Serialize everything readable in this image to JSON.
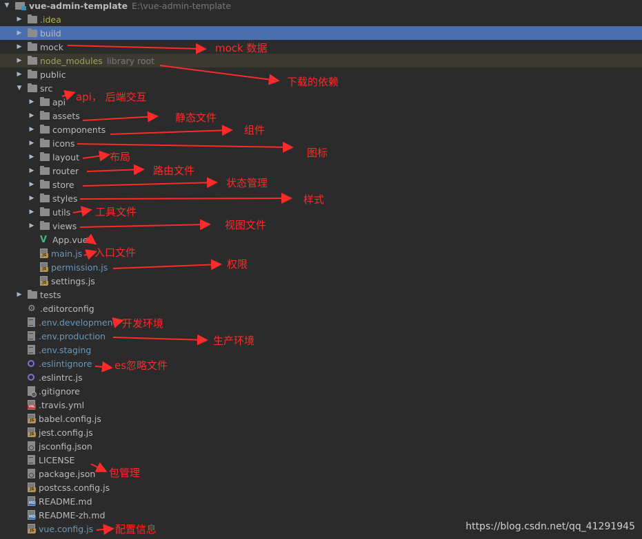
{
  "project": {
    "name": "vue-admin-template",
    "path": "E:\\vue-admin-template"
  },
  "tree": [
    {
      "label": ".idea",
      "type": "folder",
      "level": 1,
      "color": "idea"
    },
    {
      "label": "build",
      "type": "folder",
      "level": 1,
      "selected": true
    },
    {
      "label": "mock",
      "type": "folder",
      "level": 1
    },
    {
      "label": "node_modules",
      "type": "folder",
      "level": 1,
      "color": "olive",
      "lib": true,
      "tag": "library root"
    },
    {
      "label": "public",
      "type": "folder",
      "level": 1
    },
    {
      "label": "src",
      "type": "folder",
      "level": 1,
      "expanded": true
    },
    {
      "label": "api",
      "type": "folder",
      "level": 2
    },
    {
      "label": "assets",
      "type": "folder",
      "level": 2
    },
    {
      "label": "components",
      "type": "folder",
      "level": 2
    },
    {
      "label": "icons",
      "type": "folder",
      "level": 2
    },
    {
      "label": "layout",
      "type": "folder",
      "level": 2
    },
    {
      "label": "router",
      "type": "folder",
      "level": 2
    },
    {
      "label": "store",
      "type": "folder",
      "level": 2
    },
    {
      "label": "styles",
      "type": "folder",
      "level": 2
    },
    {
      "label": "utils",
      "type": "folder",
      "level": 2
    },
    {
      "label": "views",
      "type": "folder",
      "level": 2
    },
    {
      "label": "App.vue",
      "type": "vue",
      "level": 2
    },
    {
      "label": "main.js",
      "type": "js",
      "level": 2,
      "color": "blue"
    },
    {
      "label": "permission.js",
      "type": "js",
      "level": 2,
      "color": "blue"
    },
    {
      "label": "settings.js",
      "type": "js",
      "level": 2
    },
    {
      "label": "tests",
      "type": "folder",
      "level": 1
    },
    {
      "label": ".editorconfig",
      "type": "gear",
      "level": 1
    },
    {
      "label": ".env.development",
      "type": "text",
      "level": 1,
      "color": "blue"
    },
    {
      "label": ".env.production",
      "type": "text",
      "level": 1,
      "color": "blue"
    },
    {
      "label": ".env.staging",
      "type": "text",
      "level": 1,
      "color": "blue"
    },
    {
      "label": ".eslintignore",
      "type": "ring",
      "level": 1,
      "color": "blue"
    },
    {
      "label": ".eslintrc.js",
      "type": "ring",
      "level": 1
    },
    {
      "label": ".gitignore",
      "type": "git",
      "level": 1
    },
    {
      "label": ".travis.yml",
      "type": "yml",
      "level": 1
    },
    {
      "label": "babel.config.js",
      "type": "js",
      "level": 1
    },
    {
      "label": "jest.config.js",
      "type": "js",
      "level": 1
    },
    {
      "label": "jsconfig.json",
      "type": "json",
      "level": 1
    },
    {
      "label": "LICENSE",
      "type": "text",
      "level": 1
    },
    {
      "label": "package.json",
      "type": "json",
      "level": 1
    },
    {
      "label": "postcss.config.js",
      "type": "js",
      "level": 1
    },
    {
      "label": "README.md",
      "type": "md",
      "level": 1
    },
    {
      "label": "README-zh.md",
      "type": "md",
      "level": 1
    },
    {
      "label": "vue.config.js",
      "type": "js",
      "level": 1,
      "color": "blue"
    }
  ],
  "annotations": {
    "mock": "mock 数据",
    "node_modules": "下载的依赖",
    "api": "api，  后端交互",
    "assets": "静态文件",
    "components": "组件",
    "icons": "图标",
    "layout": "布局",
    "router": "路由文件",
    "store": "状态管理",
    "styles": "样式",
    "utils": "工具文件",
    "views": "视图文件",
    "entry": "入口文件",
    "permission": "权限",
    "env_development": "开发环境",
    "env_production": "生产环境",
    "eslintignore": "es忽略文件",
    "package": "包管理",
    "vue_config": "配置信息"
  },
  "watermark": "https://blog.csdn.net/qq_41291945"
}
